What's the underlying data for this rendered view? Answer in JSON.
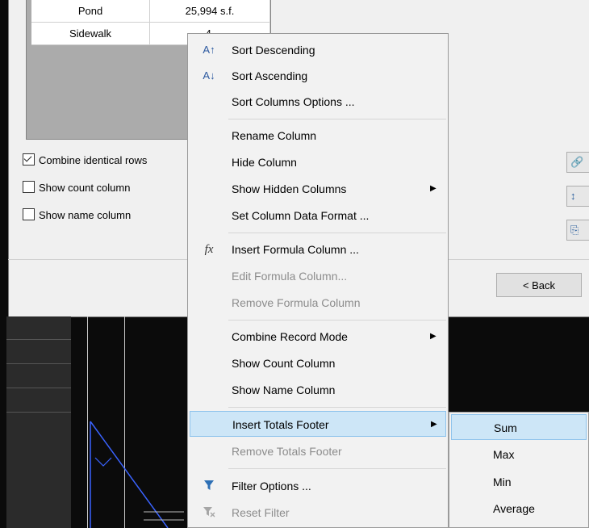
{
  "table": {
    "rows": [
      {
        "name": "Pond",
        "value": "25,994 s.f."
      },
      {
        "name": "Sidewalk",
        "value": "4."
      }
    ]
  },
  "options": {
    "combine_identical_rows": {
      "label": "Combine identical rows",
      "checked": true
    },
    "show_count_column": {
      "label": "Show count column",
      "checked": false
    },
    "show_name_column": {
      "label": "Show name column",
      "checked": false
    }
  },
  "buttons": {
    "back": "< Back"
  },
  "context_menu": {
    "sort_descending": "Sort Descending",
    "sort_ascending": "Sort Ascending",
    "sort_columns_options": "Sort Columns Options ...",
    "rename_column": "Rename Column",
    "hide_column": "Hide Column",
    "show_hidden_columns": "Show Hidden Columns",
    "set_column_data_format": "Set Column Data Format ...",
    "insert_formula_column": "Insert Formula Column ...",
    "edit_formula_column": "Edit Formula Column...",
    "remove_formula_column": "Remove Formula Column",
    "combine_record_mode": "Combine Record Mode",
    "show_count_column": "Show Count Column",
    "show_name_column": "Show Name Column",
    "insert_totals_footer": "Insert Totals Footer",
    "remove_totals_footer": "Remove Totals Footer",
    "filter_options": "Filter Options ...",
    "reset_filter": "Reset Filter"
  },
  "submenu": {
    "sum": "Sum",
    "max": "Max",
    "min": "Min",
    "average": "Average"
  },
  "icons": {
    "sort_desc": "sort-descending-icon",
    "sort_asc": "sort-ascending-icon",
    "formula": "fx-icon",
    "filter": "filter-icon",
    "reset_filter": "reset-filter-icon"
  },
  "colors": {
    "highlight": "#cde6f7",
    "highlight_border": "#8ec3ec",
    "disabled_text": "#8c8c8c"
  }
}
